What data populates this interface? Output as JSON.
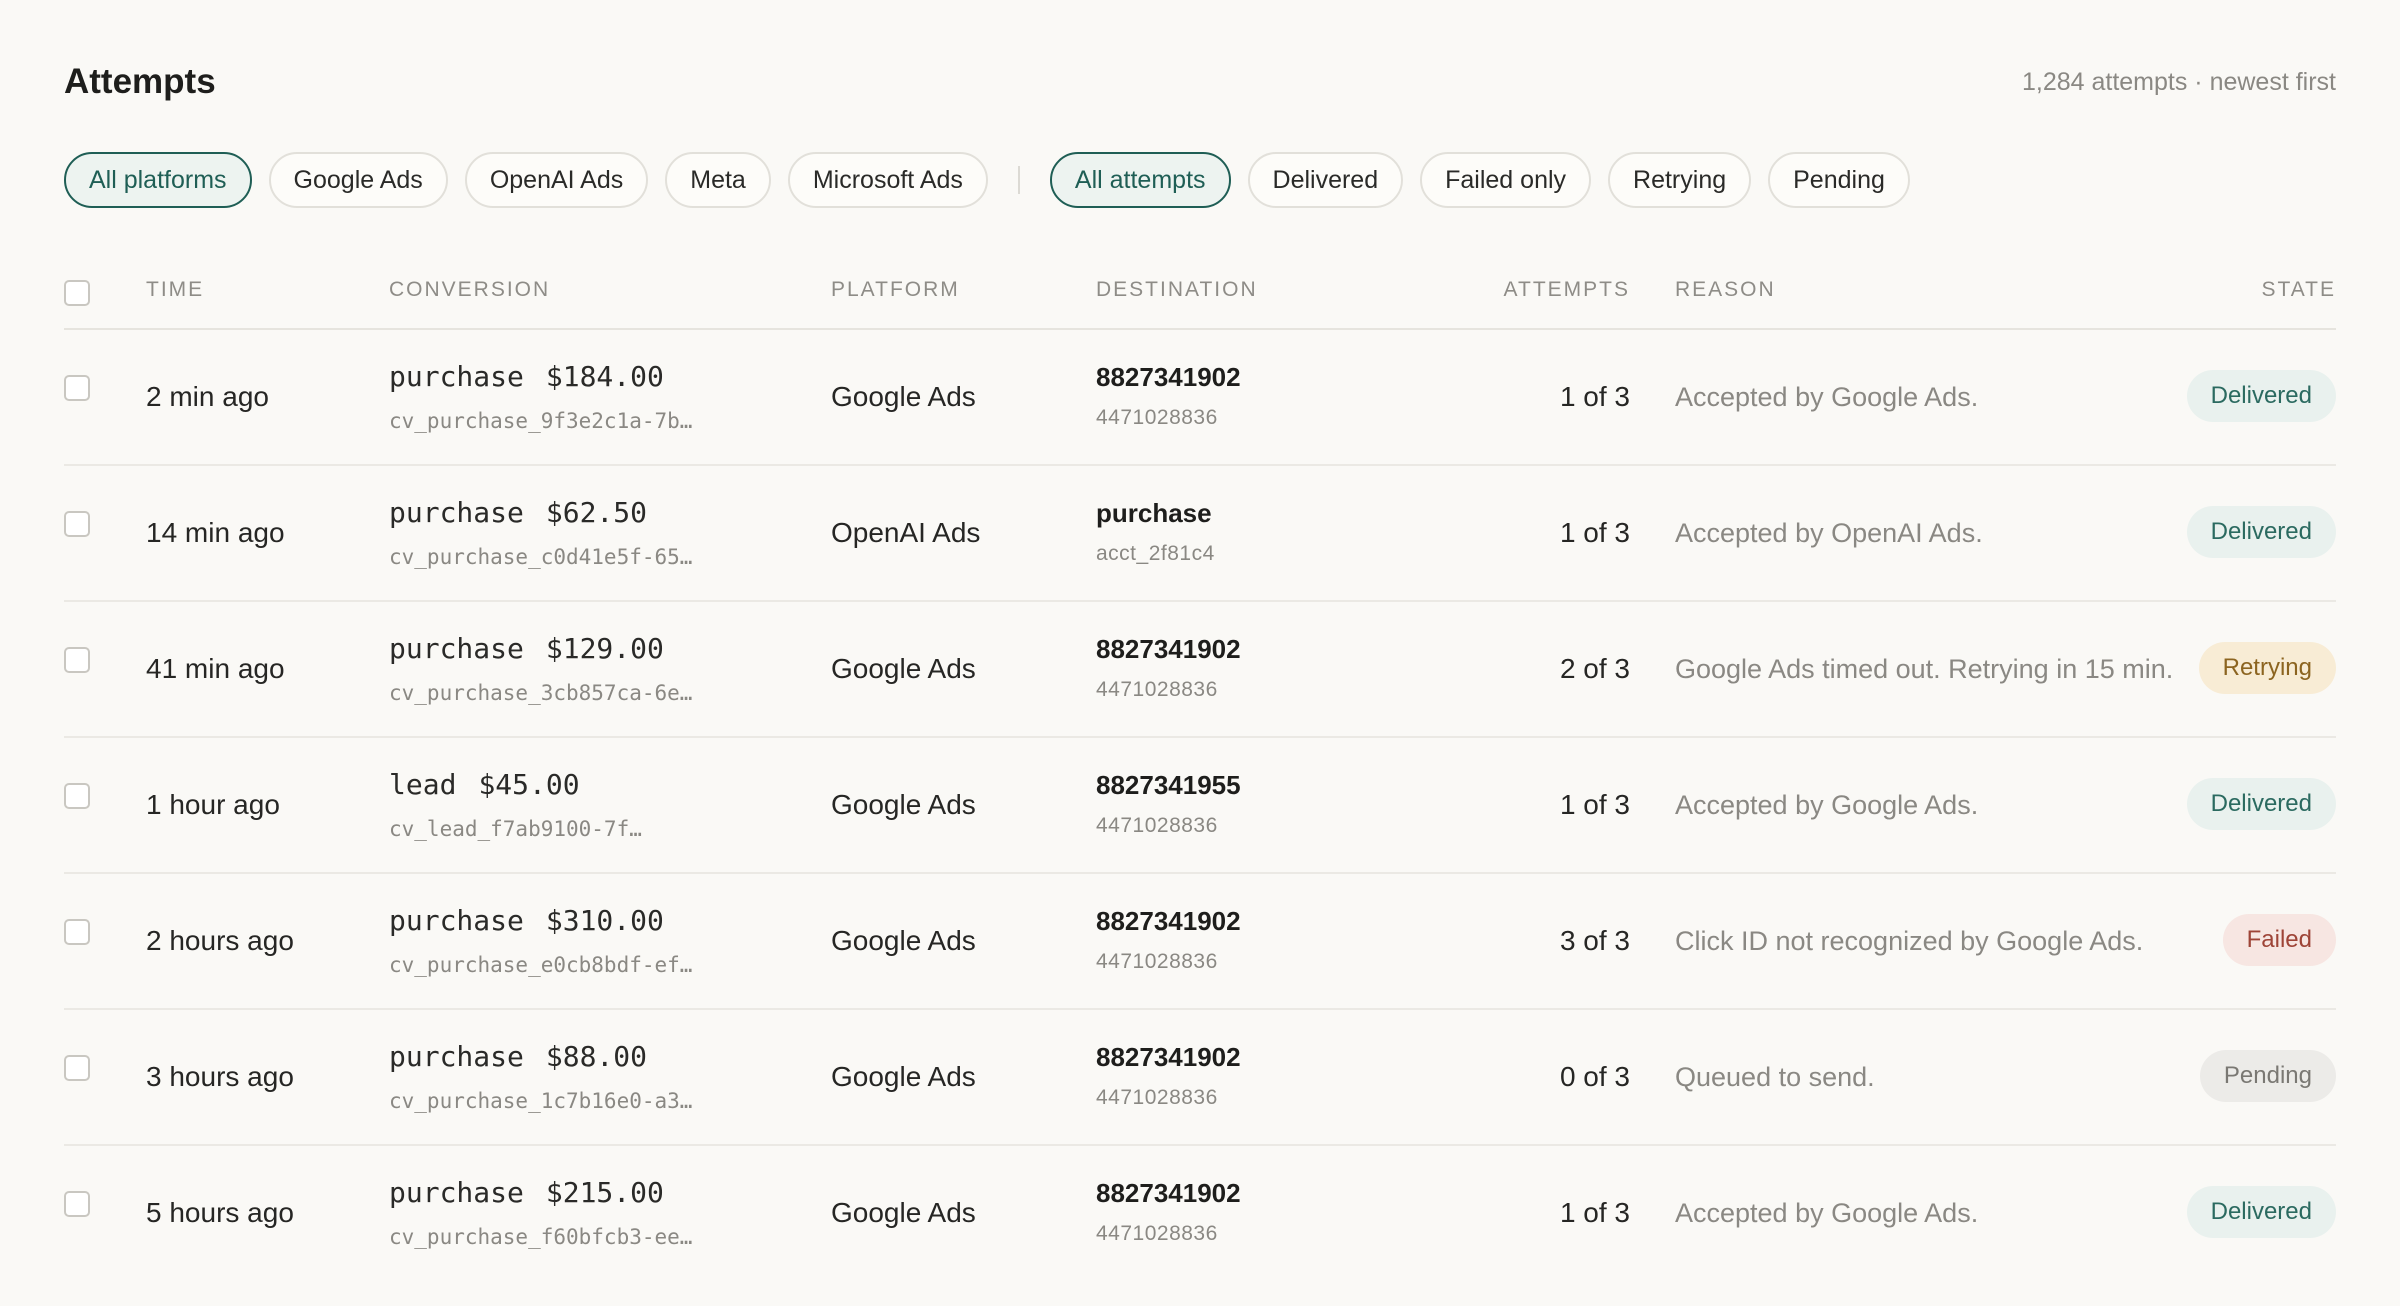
{
  "header": {
    "title": "Attempts",
    "summary": "1,284 attempts · newest first"
  },
  "filters": {
    "platforms": [
      "All platforms",
      "Google Ads",
      "OpenAI Ads",
      "Meta",
      "Microsoft Ads"
    ],
    "platform_active": "All platforms",
    "states": [
      "All attempts",
      "Delivered",
      "Failed only",
      "Retrying",
      "Pending"
    ],
    "state_active": "All attempts"
  },
  "table": {
    "columns": {
      "time": "TIME",
      "conversion": "CONVERSION",
      "platform": "PLATFORM",
      "destination": "DESTINATION",
      "attempts": "ATTEMPTS",
      "reason": "REASON",
      "state": "STATE"
    },
    "rows": [
      {
        "time": "2 min ago",
        "event": "purchase",
        "amount": "$184.00",
        "conversion_id": "cv_purchase_9f3e2c1a-7b…",
        "platform": "Google Ads",
        "destination": "8827341902",
        "destination_sub": "4471028836",
        "attempts": "1 of 3",
        "reason": "Accepted by Google Ads.",
        "state": "Delivered",
        "state_kind": "delivered"
      },
      {
        "time": "14 min ago",
        "event": "purchase",
        "amount": "$62.50",
        "conversion_id": "cv_purchase_c0d41e5f-65…",
        "platform": "OpenAI Ads",
        "destination": "purchase",
        "destination_sub": "acct_2f81c4",
        "attempts": "1 of 3",
        "reason": "Accepted by OpenAI Ads.",
        "state": "Delivered",
        "state_kind": "delivered"
      },
      {
        "time": "41 min ago",
        "event": "purchase",
        "amount": "$129.00",
        "conversion_id": "cv_purchase_3cb857ca-6e…",
        "platform": "Google Ads",
        "destination": "8827341902",
        "destination_sub": "4471028836",
        "attempts": "2 of 3",
        "reason": "Google Ads timed out. Retrying in 15 min.",
        "state": "Retrying",
        "state_kind": "retrying"
      },
      {
        "time": "1 hour ago",
        "event": "lead",
        "amount": "$45.00",
        "conversion_id": "cv_lead_f7ab9100-7f…",
        "platform": "Google Ads",
        "destination": "8827341955",
        "destination_sub": "4471028836",
        "attempts": "1 of 3",
        "reason": "Accepted by Google Ads.",
        "state": "Delivered",
        "state_kind": "delivered"
      },
      {
        "time": "2 hours ago",
        "event": "purchase",
        "amount": "$310.00",
        "conversion_id": "cv_purchase_e0cb8bdf-ef…",
        "platform": "Google Ads",
        "destination": "8827341902",
        "destination_sub": "4471028836",
        "attempts": "3 of 3",
        "reason": "Click ID not recognized by Google Ads.",
        "state": "Failed",
        "state_kind": "failed"
      },
      {
        "time": "3 hours ago",
        "event": "purchase",
        "amount": "$88.00",
        "conversion_id": "cv_purchase_1c7b16e0-a3…",
        "platform": "Google Ads",
        "destination": "8827341902",
        "destination_sub": "4471028836",
        "attempts": "0 of 3",
        "reason": "Queued to send.",
        "state": "Pending",
        "state_kind": "pending"
      },
      {
        "time": "5 hours ago",
        "event": "purchase",
        "amount": "$215.00",
        "conversion_id": "cv_purchase_f60bfcb3-ee…",
        "platform": "Google Ads",
        "destination": "8827341902",
        "destination_sub": "4471028836",
        "attempts": "1 of 3",
        "reason": "Accepted by Google Ads.",
        "state": "Delivered",
        "state_kind": "delivered"
      }
    ]
  }
}
